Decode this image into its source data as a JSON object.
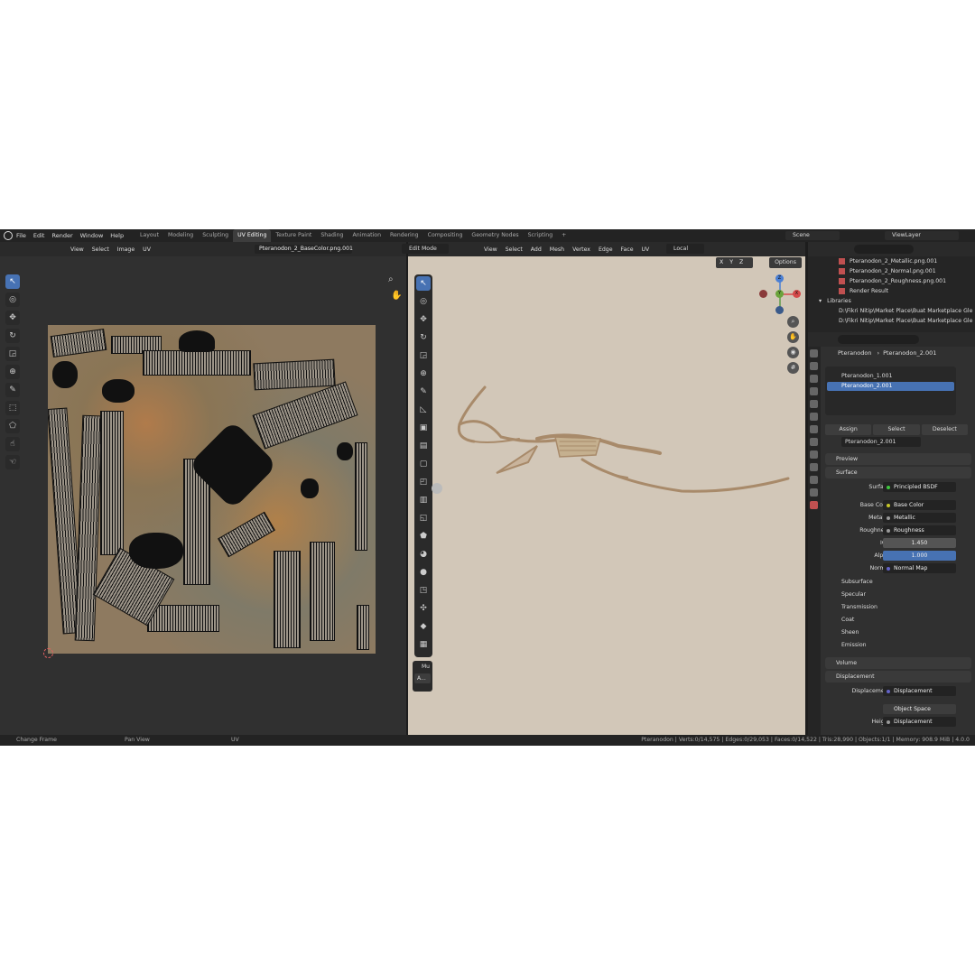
{
  "menu": [
    "File",
    "Edit",
    "Render",
    "Window",
    "Help"
  ],
  "workspaces": [
    "Layout",
    "Modeling",
    "Sculpting",
    "UV Editing",
    "Texture Paint",
    "Shading",
    "Animation",
    "Rendering",
    "Compositing",
    "Geometry Nodes",
    "Scripting",
    "+"
  ],
  "active_workspace": "UV Editing",
  "scene": "Scene",
  "view_layer": "ViewLayer",
  "uv_editor": {
    "menus": [
      "View",
      "Select",
      "Image",
      "UV"
    ],
    "image_name": "Pteranodon_2_BaseColor.png.001"
  },
  "viewport": {
    "mode": "Edit Mode",
    "menus": [
      "View",
      "Select",
      "Add",
      "Mesh",
      "Vertex",
      "Edge",
      "Face",
      "UV"
    ],
    "orientation": "Local",
    "axes": [
      "X",
      "Y",
      "Z"
    ],
    "options": "Options",
    "side_label": "Mu",
    "side_btn": "A..."
  },
  "outliner": {
    "items": [
      "Pteranodon_2_Metallic.png.001",
      "Pteranodon_2_Normal.png.001",
      "Pteranodon_2_Roughness.png.001",
      "Render Result"
    ],
    "libraries_label": "Libraries",
    "libraries": [
      "D:\\Fikri Nitip\\Market Place\\Buat Marketplace Gle",
      "D:\\Fikri Nitip\\Market Place\\Buat Marketplace Gle"
    ]
  },
  "properties": {
    "object": "Pteranodon",
    "material": "Pteranodon_2.001",
    "slots": [
      "Pteranodon_1.001",
      "Pteranodon_2.001"
    ],
    "buttons": [
      "Assign",
      "Select",
      "Deselect"
    ],
    "mat_field": "Pteranodon_2.001",
    "panels": {
      "preview": "Preview",
      "surface": "Surface",
      "volume": "Volume",
      "displacement": "Displacement"
    },
    "rows": {
      "surface": {
        "label": "Surface",
        "value": "Principled BSDF"
      },
      "base_color": {
        "label": "Base Color",
        "value": "Base Color"
      },
      "metallic": {
        "label": "Metallic",
        "value": "Metallic"
      },
      "roughness": {
        "label": "Roughness",
        "value": "Roughness"
      },
      "ior": {
        "label": "IOR",
        "value": "1.450"
      },
      "alpha": {
        "label": "Alpha",
        "value": "1.000"
      },
      "normal": {
        "label": "Normal",
        "value": "Normal Map"
      },
      "disp": {
        "label": "Displacement",
        "value": "Displacement"
      },
      "space": {
        "value": "Object Space"
      },
      "height": {
        "label": "Height",
        "value": "Displacement"
      }
    },
    "subpanels": [
      "Subsurface",
      "Specular",
      "Transmission",
      "Coat",
      "Sheen",
      "Emission"
    ]
  },
  "status": {
    "left": "Change Frame",
    "middle": "Pan View",
    "right_label": "UV",
    "stats": "Pteranodon | Verts:0/14,575 | Edges:0/29,053 | Faces:0/14,522 | Tris:28,990 | Objects:1/1 | Memory: 908.9 MiB | 4.0.0"
  },
  "colors": {
    "accent": "#4772b3",
    "viewport_bg": "#d2c7b8",
    "texture_orange": "#b07b4b"
  }
}
